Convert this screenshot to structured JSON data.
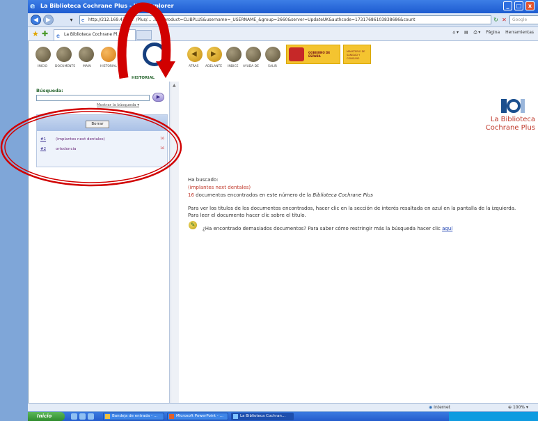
{
  "window": {
    "title": "La Biblioteca Cochrane Plus - W… Explorer",
    "minimize_glyph": "_",
    "maximize_glyph": "□",
    "close_glyph": "x"
  },
  "addressbar": {
    "back_glyph": "◀",
    "forward_glyph": "▶",
    "url": "http://212.169.42.7/… /Plus/… .asp?product=CLIBPLUS&username=_USERNAME_&group=2660&server=UpdateUK&authcode=17317686103838686&count",
    "search_placeholder": "Google"
  },
  "tabbar": {
    "tab_title": "La Biblioteca Cochrane Pl…",
    "commands": [
      "Página",
      "Herramientas"
    ]
  },
  "site_toolbar": {
    "left_buttons": [
      "INICIO",
      "DOCUMENTS",
      "MAIN",
      "HISTORIAL"
    ],
    "right_buttons": [
      "ATRAS",
      "ADELANTE",
      "INDICE",
      "AYUDA DE",
      "SALIR"
    ],
    "historial_label": "HISTORIAL",
    "gov_logo_text": "GOBIERNO DE ESPAÑA",
    "ministry_logo_text": "MINISTERIO DE SANIDAD Y CONSUMO"
  },
  "left_panel": {
    "busqueda_label": "Búsqueda:",
    "search_value": "",
    "mostrar_link": "Mostrar la búsqueda",
    "borrar_label": "Borrar",
    "history": [
      {
        "num": "#1",
        "term": "(implantes next dentales)",
        "count": "16"
      },
      {
        "num": "#2",
        "term": "ortodoncia",
        "count": "16"
      }
    ]
  },
  "main": {
    "logo_line1": "La Biblioteca",
    "logo_line2": "Cochrane Plus",
    "heading": "Ha buscado:",
    "query": "(implantes next dentales)",
    "count_number": "16",
    "count_text": " documentos encontrados en este número de la ",
    "count_pub": "Biblioteca Cochrane Plus",
    "instructions": "Para ver los títulos de los documentos encontrados, hacer clic en la sección de interés resaltada en azul en la pantalla de la izquierda. Para leer el documento hacer clic sobre el título.",
    "tip_text": "¿Ha encontrado demasiados documentos? Para saber cómo restringir más la búsqueda hacer clic ",
    "tip_link": "aquí"
  },
  "statusbar": {
    "zone": "Internet",
    "zoom": "100%"
  },
  "taskbar": {
    "start_label": "Inicio",
    "tasks": [
      "Bandeja de entrada - …",
      "Microsoft PowerPoint - …",
      "La Biblioteca Cochran…"
    ]
  },
  "annotations": {
    "arrow_color": "#d10000",
    "ellipse_color": "#d10000"
  }
}
